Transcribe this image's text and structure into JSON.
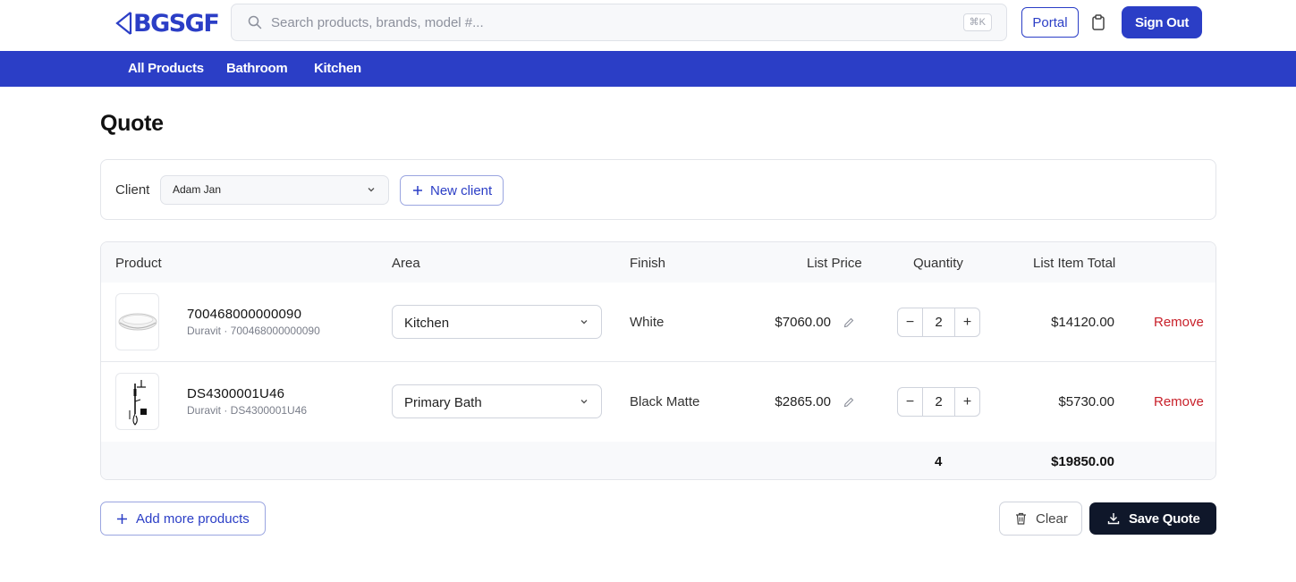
{
  "brand": {
    "logo_text": "BGSGF",
    "accent": "#2b3ec6"
  },
  "header": {
    "search": {
      "placeholder": "Search products, brands, model #...",
      "value": "",
      "shortcut": "⌘K"
    },
    "portal_label": "Portal",
    "signout_label": "Sign Out"
  },
  "nav": {
    "items": [
      {
        "label": "All Products"
      },
      {
        "label": "Bathroom"
      },
      {
        "label": "Kitchen"
      }
    ]
  },
  "page": {
    "title": "Quote"
  },
  "client": {
    "label": "Client",
    "selected": "Adam Jan",
    "new_client_label": "New client"
  },
  "table": {
    "headers": {
      "product": "Product",
      "area": "Area",
      "finish": "Finish",
      "list_price": "List Price",
      "quantity": "Quantity",
      "list_item_total": "List Item Total"
    },
    "rows": [
      {
        "name": "700468000000090",
        "sub": "Duravit · 700468000000090",
        "area": "Kitchen",
        "finish": "White",
        "price": "$7060.00",
        "qty": "2",
        "total": "$14120.00",
        "remove": "Remove",
        "thumb_icon": "basin-icon"
      },
      {
        "name": "DS4300001U46",
        "sub": "Duravit · DS4300001U46",
        "area": "Primary Bath",
        "finish": "Black Matte",
        "price": "$2865.00",
        "qty": "2",
        "total": "$5730.00",
        "remove": "Remove",
        "thumb_icon": "shower-icon"
      }
    ],
    "totals": {
      "quantity": "4",
      "sum": "$19850.00"
    },
    "minus": "−",
    "plus": "+"
  },
  "footer": {
    "add_more_label": "Add more products",
    "clear_label": "Clear",
    "save_label": "Save Quote"
  }
}
